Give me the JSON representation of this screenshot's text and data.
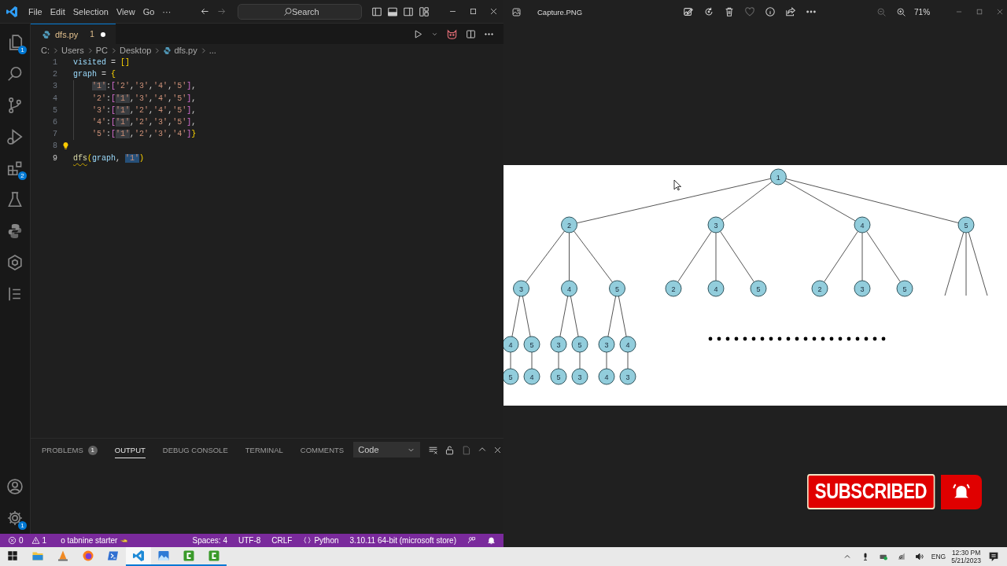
{
  "vscode": {
    "menu": [
      "File",
      "Edit",
      "Selection",
      "View",
      "Go",
      "···"
    ],
    "search": {
      "placeholder": "Search"
    },
    "activity_bar": [
      {
        "kind": "files",
        "badge": "1",
        "selected": false
      },
      {
        "kind": "search",
        "selected": false
      },
      {
        "kind": "branch",
        "selected": false
      },
      {
        "kind": "debug",
        "selected": false
      },
      {
        "kind": "extensions",
        "badge": "2",
        "selected": false
      },
      {
        "kind": "flask",
        "selected": false
      },
      {
        "kind": "snake",
        "selected": false
      },
      {
        "kind": "hexagon",
        "selected": false
      },
      {
        "kind": "list",
        "selected": false
      }
    ],
    "activity_bottom": [
      {
        "kind": "account"
      },
      {
        "kind": "gear",
        "badge": "1"
      }
    ],
    "tab": {
      "label": "dfs.py",
      "problems": "1",
      "dirty": true
    },
    "breadcrumbs": [
      {
        "label": "C:",
        "kind": "text"
      },
      {
        "label": "Users",
        "kind": "text"
      },
      {
        "label": "PC",
        "kind": "text"
      },
      {
        "label": "Desktop",
        "kind": "text"
      },
      {
        "label": "dfs.py",
        "kind": "file"
      },
      {
        "label": "...",
        "kind": "text"
      }
    ],
    "code_lines": [
      {
        "number": "1",
        "lightbulb": false,
        "indented": false,
        "segments": [
          {
            "text": "visited = []",
            "kind": "plain"
          }
        ]
      },
      {
        "number": "2",
        "lightbulb": false,
        "indented": false,
        "segments": [
          {
            "text": "graph = {",
            "kind": "plain"
          }
        ]
      },
      {
        "number": "3",
        "lightbulb": false,
        "indented": true,
        "segments": [
          {
            "text": "'1'",
            "kind": "occurrence"
          },
          {
            "text": ":['2','3','4','5'],",
            "kind": "plain"
          }
        ]
      },
      {
        "number": "4",
        "lightbulb": false,
        "indented": true,
        "segments": [
          {
            "text": "'2':[",
            "kind": "plain"
          },
          {
            "text": "'1'",
            "kind": "occurrence"
          },
          {
            "text": ",'3','4','5'],",
            "kind": "plain"
          }
        ]
      },
      {
        "number": "5",
        "lightbulb": false,
        "indented": true,
        "segments": [
          {
            "text": "'3':[",
            "kind": "plain"
          },
          {
            "text": "'1'",
            "kind": "occurrence"
          },
          {
            "text": ",'2','4','5'],",
            "kind": "plain"
          }
        ]
      },
      {
        "number": "6",
        "lightbulb": false,
        "indented": true,
        "segments": [
          {
            "text": "'4':[",
            "kind": "plain"
          },
          {
            "text": "'1'",
            "kind": "occurrence"
          },
          {
            "text": ",'2','3','5'],",
            "kind": "plain"
          }
        ]
      },
      {
        "number": "7",
        "lightbulb": false,
        "indented": true,
        "segments": [
          {
            "text": "'5':[",
            "kind": "plain"
          },
          {
            "text": "'1'",
            "kind": "occurrence"
          },
          {
            "text": ",'2','3','4']}",
            "kind": "plain"
          }
        ]
      },
      {
        "number": "8",
        "lightbulb": true
      },
      {
        "number": "9",
        "lightbulb": false,
        "indented": false,
        "segments": [
          {
            "text": "dfs",
            "kind": "warning"
          },
          {
            "text": "(graph, ",
            "kind": "plain"
          },
          {
            "text": "'1'",
            "kind": "selection"
          },
          {
            "text": ")",
            "kind": "plain"
          }
        ]
      }
    ],
    "panel": {
      "tabs": [
        {
          "label": "PROBLEMS",
          "badge": "1",
          "selected": false
        },
        {
          "label": "OUTPUT",
          "selected": true
        },
        {
          "label": "DEBUG CONSOLE",
          "selected": false
        },
        {
          "label": "TERMINAL",
          "selected": false
        },
        {
          "label": "COMMENTS",
          "selected": false
        }
      ],
      "output_channel": "Code"
    },
    "status_bar": {
      "left": [
        {
          "kind": "error",
          "text": "0"
        },
        {
          "kind": "warning",
          "text": "1"
        },
        {
          "kind": "hand",
          "text": "o tabnine starter"
        }
      ],
      "right": [
        {
          "kind": "plain",
          "text": "Spaces: 4"
        },
        {
          "kind": "plain",
          "text": "UTF-8"
        },
        {
          "kind": "plain",
          "text": "CRLF"
        },
        {
          "kind": "braces",
          "text": "Python"
        },
        {
          "kind": "plain",
          "text": "3.10.11 64-bit (microsoft store)"
        },
        {
          "kind": "feedback"
        },
        {
          "kind": "bell"
        }
      ]
    }
  },
  "photos": {
    "file_name": "Capture.PNG",
    "zoom": "71%",
    "tree": {
      "label": "1",
      "children": [
        {
          "label": "2",
          "children": [
            {
              "label": "3",
              "children": [
                {
                  "label": "4",
                  "children": [
                    {
                      "label": "5"
                    }
                  ]
                },
                {
                  "label": "5",
                  "children": [
                    {
                      "label": "4"
                    }
                  ]
                }
              ]
            },
            {
              "label": "4",
              "children": [
                {
                  "label": "3",
                  "children": [
                    {
                      "label": "5"
                    }
                  ]
                },
                {
                  "label": "5",
                  "children": [
                    {
                      "label": "3"
                    }
                  ]
                }
              ]
            },
            {
              "label": "5",
              "children": [
                {
                  "label": "3",
                  "children": [
                    {
                      "label": "4"
                    }
                  ]
                },
                {
                  "label": "4",
                  "children": [
                    {
                      "label": "3"
                    }
                  ]
                }
              ]
            }
          ]
        },
        {
          "label": "3",
          "children": [
            {
              "label": "2"
            },
            {
              "label": "4"
            },
            {
              "label": "5"
            }
          ]
        },
        {
          "label": "4",
          "children": [
            {
              "label": "2"
            },
            {
              "label": "3"
            },
            {
              "label": "5"
            }
          ]
        },
        {
          "label": "5",
          "truncated": true
        }
      ]
    },
    "continued": true
  },
  "overlay": {
    "label": "SUBSCRIBED"
  },
  "taskbar": {
    "apps": [
      {
        "kind": "folder",
        "running": false,
        "active": false
      },
      {
        "kind": "cone",
        "running": false,
        "active": false
      },
      {
        "kind": "browser",
        "running": false,
        "active": false
      },
      {
        "kind": "terminal",
        "running": false,
        "active": false
      },
      {
        "kind": "ribbon",
        "running": true,
        "active": true
      },
      {
        "kind": "landscape",
        "running": true,
        "active": false
      },
      {
        "kind": "tile",
        "running": true,
        "active": false
      },
      {
        "kind": "tile",
        "running": true,
        "active": false
      }
    ],
    "language": "ENG",
    "time": "12:30 PM",
    "date": "5/21/2023"
  }
}
